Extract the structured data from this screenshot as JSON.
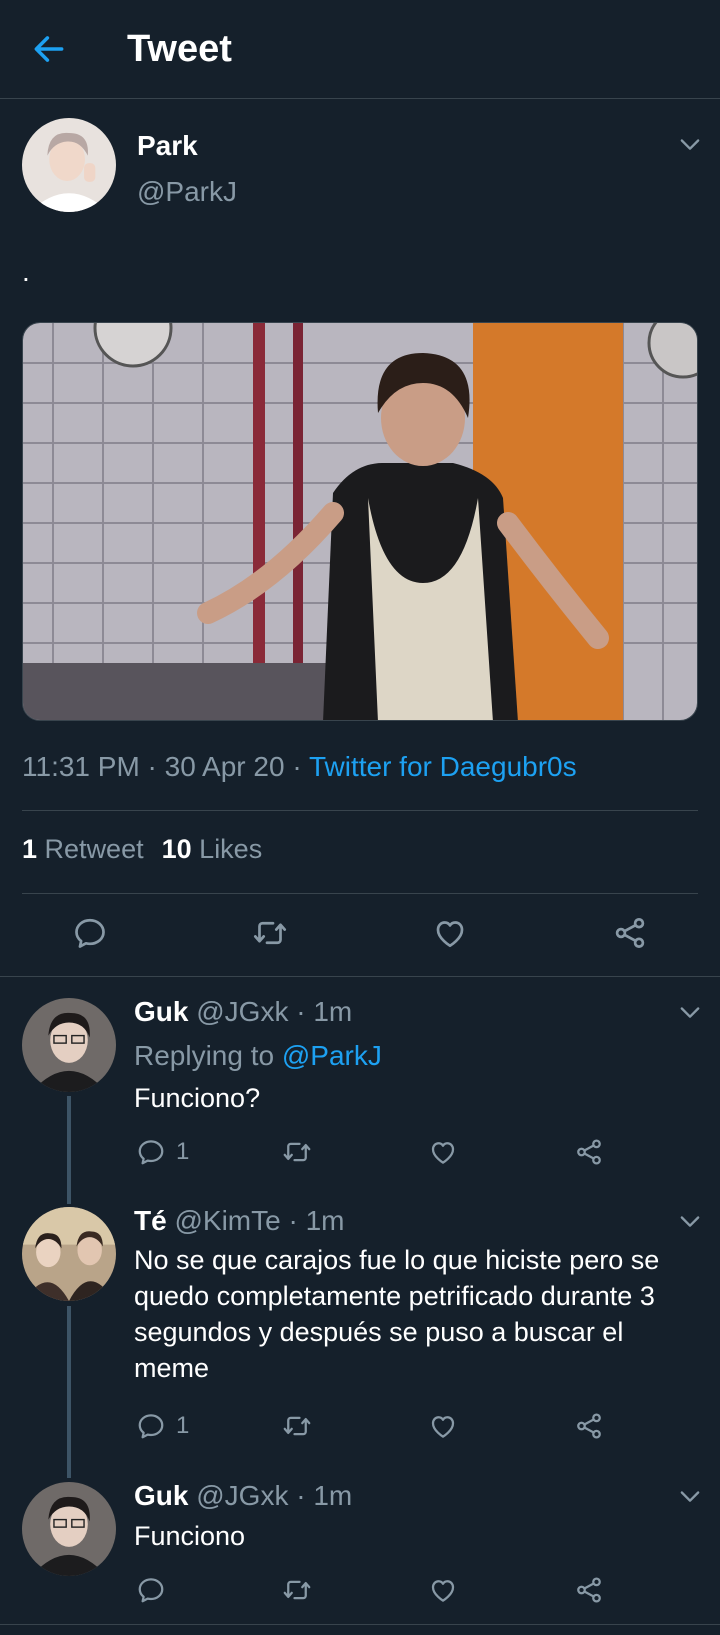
{
  "header": {
    "title": "Tweet",
    "back_icon": "arrow-left-icon"
  },
  "main_tweet": {
    "author_name": "Park",
    "author_handle": "@ParkJ",
    "text": ".",
    "time": "11:31 PM",
    "date": "30 Apr 20",
    "source": "Twitter for Daegubr0s",
    "separator": " · ",
    "retweet_count": "1",
    "retweet_label": "Retweet",
    "like_count": "10",
    "like_label": "Likes",
    "actions": [
      "reply-icon",
      "retweet-icon",
      "like-icon",
      "share-icon"
    ]
  },
  "replies": [
    {
      "name": "Guk",
      "handle": "@JGxk",
      "time": "· 1m",
      "replying_prefix": "Replying to",
      "replying_to": "@ParkJ",
      "text": "Funciono?",
      "reply_count": "1"
    },
    {
      "name": "Té",
      "handle": "@KimTe",
      "time": "· 1m",
      "text": "No se que carajos fue lo que hiciste pero se quedo completamente petrificado durante 3 segundos y después se puso a buscar el meme",
      "reply_count": "1"
    },
    {
      "name": "Guk",
      "handle": "@JGxk",
      "time": "· 1m",
      "text": "Funciono",
      "reply_count": ""
    }
  ],
  "colors": {
    "background": "#15202b",
    "accent": "#1da1f2",
    "secondary_text": "#8899a6",
    "divider": "#38444d"
  }
}
